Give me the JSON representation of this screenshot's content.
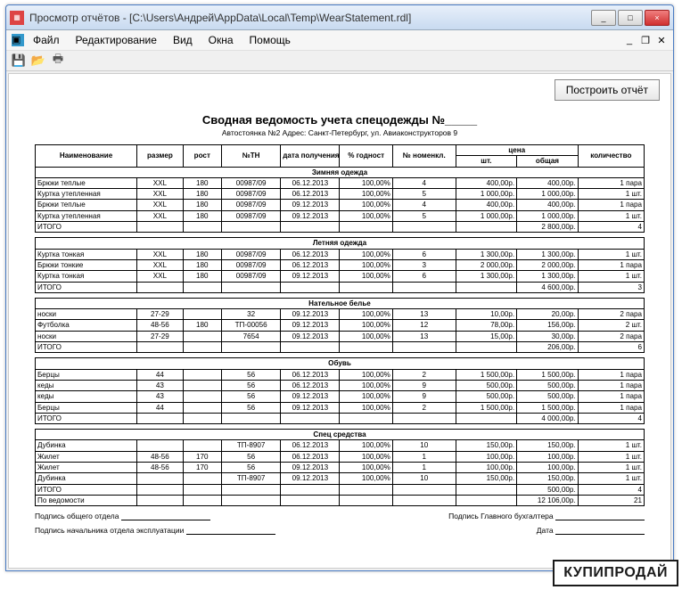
{
  "window": {
    "title": "Просмотр отчётов - [C:\\Users\\Андрей\\AppData\\Local\\Temp\\WearStatement.rdl]",
    "min": "_",
    "max": "□",
    "close": "×"
  },
  "menu": {
    "file": "Файл",
    "edit": "Редактирование",
    "view": "Вид",
    "windows": "Окна",
    "help": "Помощь"
  },
  "mdi": {
    "min": "_",
    "restore": "❐",
    "close": "✕"
  },
  "actions": {
    "build": "Построить отчёт"
  },
  "report": {
    "title": "Сводная  ведомость учета  спецодежды  №_____",
    "subtitle": "Автостоянка №2   Адрес: Санкт-Петербург, ул. Авиаконструкторов 9",
    "headers": {
      "name": "Наименование",
      "size": "размер",
      "height": "рост",
      "tn": "№ТН",
      "date": "дата получения",
      "pct": "% годност",
      "nomen": "№ номенкл.",
      "price": "цена",
      "price_each": "шт.",
      "price_total": "общая",
      "qty": "количество"
    },
    "itogo": "ИТОГО",
    "povedomosti": "По ведомости",
    "groups": [
      {
        "title": "Зимняя одежда",
        "rows": [
          {
            "name": "Брюки теплые",
            "size": "XXL",
            "height": "180",
            "tn": "00987/09",
            "date": "06.12.2013",
            "pct": "100,00%",
            "nom": "4",
            "pe": "400,00р.",
            "pt": "400,00р.",
            "qty": "1 пара"
          },
          {
            "name": "Куртка утепленная",
            "size": "XXL",
            "height": "180",
            "tn": "00987/09",
            "date": "06.12.2013",
            "pct": "100,00%",
            "nom": "5",
            "pe": "1 000,00р.",
            "pt": "1 000,00р.",
            "qty": "1 шт."
          },
          {
            "name": "Брюки теплые",
            "size": "XXL",
            "height": "180",
            "tn": "00987/09",
            "date": "09.12.2013",
            "pct": "100,00%",
            "nom": "4",
            "pe": "400,00р.",
            "pt": "400,00р.",
            "qty": "1 пара"
          },
          {
            "name": "Куртка утепленная",
            "size": "XXL",
            "height": "180",
            "tn": "00987/09",
            "date": "09.12.2013",
            "pct": "100,00%",
            "nom": "5",
            "pe": "1 000,00р.",
            "pt": "1 000,00р.",
            "qty": "1 шт."
          }
        ],
        "total_pt": "2 800,00р.",
        "total_qty": "4"
      },
      {
        "title": "Летняя одежда",
        "rows": [
          {
            "name": "Куртка тонкая",
            "size": "XXL",
            "height": "180",
            "tn": "00987/09",
            "date": "06.12.2013",
            "pct": "100,00%",
            "nom": "6",
            "pe": "1 300,00р.",
            "pt": "1 300,00р.",
            "qty": "1 шт."
          },
          {
            "name": "Брюки тонкие",
            "size": "XXL",
            "height": "180",
            "tn": "00987/09",
            "date": "06.12.2013",
            "pct": "100,00%",
            "nom": "3",
            "pe": "2 000,00р.",
            "pt": "2 000,00р.",
            "qty": "1 пара"
          },
          {
            "name": "Куртка тонкая",
            "size": "XXL",
            "height": "180",
            "tn": "00987/09",
            "date": "09.12.2013",
            "pct": "100,00%",
            "nom": "6",
            "pe": "1 300,00р.",
            "pt": "1 300,00р.",
            "qty": "1 шт."
          }
        ],
        "total_pt": "4 600,00р.",
        "total_qty": "3"
      },
      {
        "title": "Нательное белье",
        "rows": [
          {
            "name": "носки",
            "size": "27-29",
            "height": "",
            "tn": "32",
            "date": "09.12.2013",
            "pct": "100,00%",
            "nom": "13",
            "pe": "10,00р.",
            "pt": "20,00р.",
            "qty": "2 пара"
          },
          {
            "name": "Футболка",
            "size": "48-56",
            "height": "180",
            "tn": "ТП-00056",
            "date": "09.12.2013",
            "pct": "100,00%",
            "nom": "12",
            "pe": "78,00р.",
            "pt": "156,00р.",
            "qty": "2 шт."
          },
          {
            "name": "носки",
            "size": "27-29",
            "height": "",
            "tn": "7654",
            "date": "09.12.2013",
            "pct": "100,00%",
            "nom": "13",
            "pe": "15,00р.",
            "pt": "30,00р.",
            "qty": "2 пара"
          }
        ],
        "total_pt": "206,00р.",
        "total_qty": "6"
      },
      {
        "title": "Обувь",
        "rows": [
          {
            "name": "Берцы",
            "size": "44",
            "height": "",
            "tn": "56",
            "date": "06.12.2013",
            "pct": "100,00%",
            "nom": "2",
            "pe": "1 500,00р.",
            "pt": "1 500,00р.",
            "qty": "1 пара"
          },
          {
            "name": "кеды",
            "size": "43",
            "height": "",
            "tn": "56",
            "date": "06.12.2013",
            "pct": "100,00%",
            "nom": "9",
            "pe": "500,00р.",
            "pt": "500,00р.",
            "qty": "1 пара"
          },
          {
            "name": "кеды",
            "size": "43",
            "height": "",
            "tn": "56",
            "date": "09.12.2013",
            "pct": "100,00%",
            "nom": "9",
            "pe": "500,00р.",
            "pt": "500,00р.",
            "qty": "1 пара"
          },
          {
            "name": "Берцы",
            "size": "44",
            "height": "",
            "tn": "56",
            "date": "09.12.2013",
            "pct": "100,00%",
            "nom": "2",
            "pe": "1 500,00р.",
            "pt": "1 500,00р.",
            "qty": "1 пара"
          }
        ],
        "total_pt": "4 000,00р.",
        "total_qty": "4"
      },
      {
        "title": "Спец средства",
        "rows": [
          {
            "name": "Дубинка",
            "size": "",
            "height": "",
            "tn": "ТП-8907",
            "date": "06.12.2013",
            "pct": "100,00%",
            "nom": "10",
            "pe": "150,00р.",
            "pt": "150,00р.",
            "qty": "1 шт."
          },
          {
            "name": "Жилет",
            "size": "48-56",
            "height": "170",
            "tn": "56",
            "date": "06.12.2013",
            "pct": "100,00%",
            "nom": "1",
            "pe": "100,00р.",
            "pt": "100,00р.",
            "qty": "1 шт."
          },
          {
            "name": "Жилет",
            "size": "48-56",
            "height": "170",
            "tn": "56",
            "date": "09.12.2013",
            "pct": "100,00%",
            "nom": "1",
            "pe": "100,00р.",
            "pt": "100,00р.",
            "qty": "1 шт."
          },
          {
            "name": "Дубинка",
            "size": "",
            "height": "",
            "tn": "ТП-8907",
            "date": "09.12.2013",
            "pct": "100,00%",
            "nom": "10",
            "pe": "150,00р.",
            "pt": "150,00р.",
            "qty": "1 шт."
          }
        ],
        "total_pt": "500,00р.",
        "total_qty": "4"
      }
    ],
    "grand_pt": "12 106,00р.",
    "grand_qty": "21",
    "sig1": "Подпись  общего отдела",
    "sig2": "Подпись   Главного  бухгалтера",
    "sig3": "Подпись начальника отдела эксплуатации",
    "sig4": "Дата"
  },
  "watermark": "КУПИПРОДАЙ"
}
